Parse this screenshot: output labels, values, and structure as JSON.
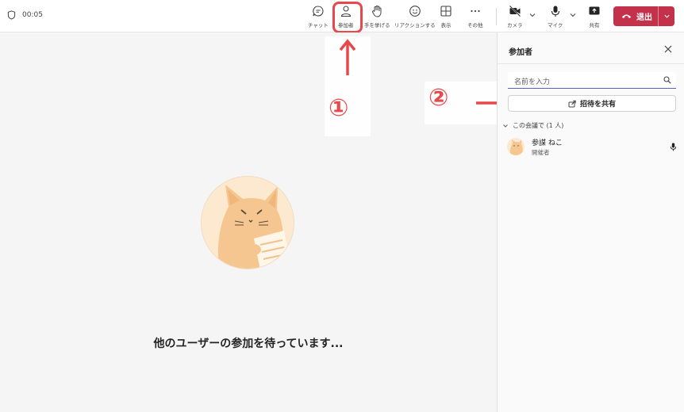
{
  "call": {
    "duration": "00:05"
  },
  "toolbar": {
    "chat": {
      "label": "チャット",
      "icon": "chat-icon"
    },
    "people": {
      "label": "参加者",
      "icon": "people-icon"
    },
    "raise_hand": {
      "label": "手を挙げる",
      "icon": "hand-icon"
    },
    "react": {
      "label": "リアクションする",
      "icon": "emoji-icon"
    },
    "view": {
      "label": "表示",
      "icon": "grid-icon"
    },
    "more": {
      "label": "その他",
      "icon": "more-icon"
    },
    "camera": {
      "label": "カメラ",
      "icon": "camera-off-icon"
    },
    "mic": {
      "label": "マイク",
      "icon": "mic-icon"
    },
    "share": {
      "label": "共有",
      "icon": "share-screen-icon"
    },
    "leave": {
      "label": "退出",
      "icon": "phone-hangup-icon"
    }
  },
  "stage": {
    "waiting_message": "他のユーザーの参加を待っています..."
  },
  "annotations": {
    "step1": "①",
    "step2": "②",
    "accent_color": "#e8484c"
  },
  "panel": {
    "title": "参加者",
    "search_placeholder": "名前を入力",
    "share_invite": "招待を共有",
    "section_label": "この会議で (1 人)",
    "participants": [
      {
        "name": "参謀 ねこ",
        "role": "開催者",
        "mic": "mic-icon"
      }
    ]
  },
  "colors": {
    "leave_button": "#c4314b",
    "brand": "#5b5fc7"
  }
}
